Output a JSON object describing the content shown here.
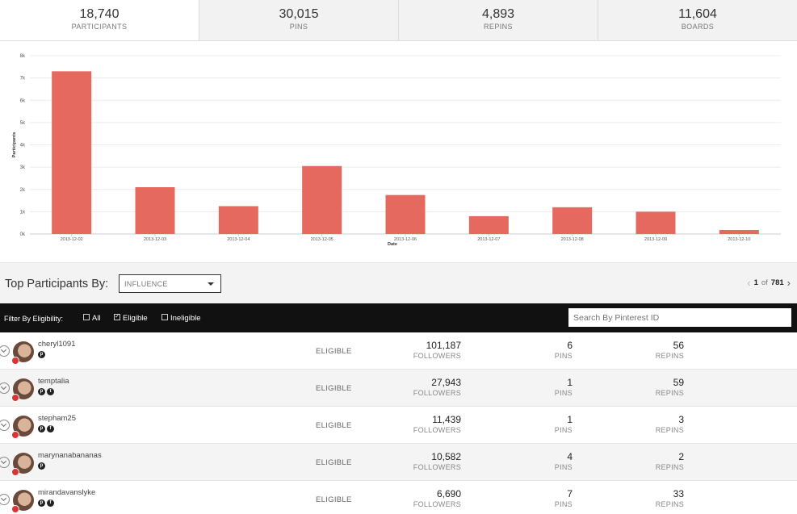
{
  "stats": [
    {
      "value": "18,740",
      "label": "PARTICIPANTS"
    },
    {
      "value": "30,015",
      "label": "PINS"
    },
    {
      "value": "4,893",
      "label": "REPINS"
    },
    {
      "value": "11,604",
      "label": "BOARDS"
    }
  ],
  "chart_data": {
    "type": "bar",
    "categories": [
      "2013-12-02",
      "2013-12-03",
      "2013-12-04",
      "2013-12-05",
      "2013-12-06",
      "2013-12-07",
      "2013-12-08",
      "2013-12-09",
      "2013-12-10"
    ],
    "values": [
      7300,
      2100,
      1250,
      3050,
      1750,
      800,
      1200,
      1000,
      180
    ],
    "xlabel": "Date",
    "ylabel": "Participants",
    "ylim": [
      0,
      8000
    ],
    "yticks": [
      "0k",
      "1k",
      "2k",
      "3k",
      "4k",
      "5k",
      "6k",
      "7k",
      "8k"
    ],
    "grid": true,
    "color": "#e5695f"
  },
  "section": {
    "title": "Top Participants By:",
    "select_value": "INFLUENCE",
    "page_current": "1",
    "page_of": "of",
    "page_total": "781"
  },
  "filter": {
    "label": "Filter By Eligibility:",
    "options": [
      {
        "label": "All",
        "checked": false
      },
      {
        "label": "Eligible",
        "checked": true
      },
      {
        "label": "Ineligible",
        "checked": false
      }
    ],
    "search_placeholder": "Search By Pinterest ID"
  },
  "rows": [
    {
      "name": "cheryl1091",
      "icons": [
        "pinterest-icon"
      ],
      "status": "ELIGIBLE",
      "followers": "101,187",
      "followers_label": "FOLLOWERS",
      "pins": "6",
      "pins_label": "PINS",
      "repins": "56",
      "repins_label": "REPINS"
    },
    {
      "name": "temptalia",
      "icons": [
        "pinterest-icon",
        "twitter-icon"
      ],
      "status": "ELIGIBLE",
      "followers": "27,943",
      "followers_label": "FOLLOWERS",
      "pins": "1",
      "pins_label": "PINS",
      "repins": "59",
      "repins_label": "REPINS"
    },
    {
      "name": "stepham25",
      "icons": [
        "pinterest-icon",
        "facebook-icon"
      ],
      "status": "ELIGIBLE",
      "followers": "11,439",
      "followers_label": "FOLLOWERS",
      "pins": "1",
      "pins_label": "PINS",
      "repins": "3",
      "repins_label": "REPINS"
    },
    {
      "name": "marynanabananas",
      "icons": [
        "pinterest-icon"
      ],
      "status": "ELIGIBLE",
      "followers": "10,582",
      "followers_label": "FOLLOWERS",
      "pins": "4",
      "pins_label": "PINS",
      "repins": "2",
      "repins_label": "REPINS"
    },
    {
      "name": "mirandavanslyke",
      "icons": [
        "pinterest-icon",
        "facebook-icon"
      ],
      "status": "ELIGIBLE",
      "followers": "6,690",
      "followers_label": "FOLLOWERS",
      "pins": "7",
      "pins_label": "PINS",
      "repins": "33",
      "repins_label": "REPINS"
    }
  ]
}
